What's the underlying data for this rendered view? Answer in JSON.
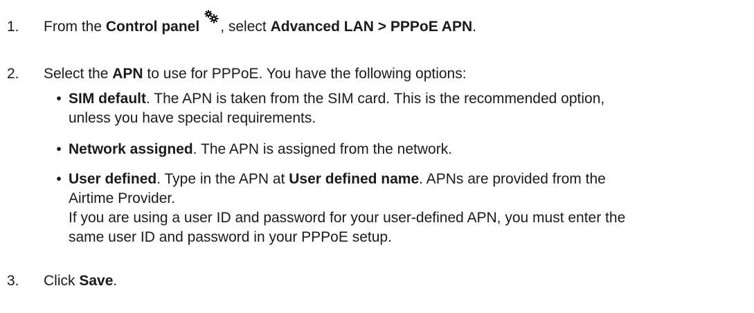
{
  "steps": [
    {
      "number": "1.",
      "prefix": "From the ",
      "control_panel": "Control panel",
      "icon": "gears-icon",
      "middle": ", select ",
      "path": "Advanced LAN > PPPoE APN",
      "suffix": "."
    },
    {
      "number": "2.",
      "prefix": "Select the ",
      "apn": "APN",
      "suffix": " to use for PPPoE. You have the following options:",
      "options": [
        {
          "name": "SIM default",
          "lines": [
            ". The APN is taken from the SIM card. This is the recommended option,",
            "unless you have special requirements."
          ]
        },
        {
          "name": "Network assigned",
          "lines": [
            ". The APN is assigned from the network."
          ]
        },
        {
          "name": "User defined",
          "line1_a": ". Type in the APN at ",
          "line1_bold": "User defined name",
          "line1_b": ". APNs are provided from the",
          "lines_rest": [
            "Airtime Provider.",
            "If you are using a user ID and password for your user-defined APN, you must enter the",
            "same user ID and password in your PPPoE setup."
          ]
        }
      ]
    },
    {
      "number": "3.",
      "prefix": "Click ",
      "save": "Save",
      "suffix": "."
    }
  ]
}
